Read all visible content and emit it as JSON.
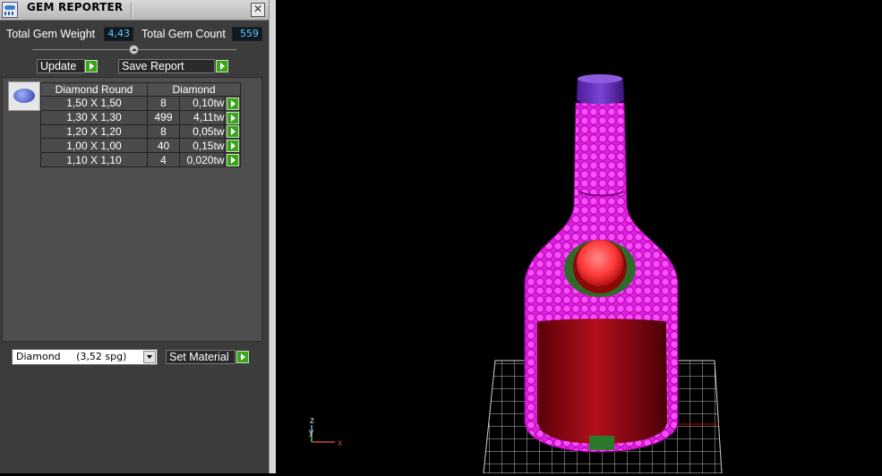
{
  "window": {
    "title": "GEM REPORTER",
    "close_symbol": "✕"
  },
  "totals": {
    "weight_label": "Total Gem Weight",
    "weight_value": "4,43",
    "count_label": "Total Gem Count",
    "count_value": "559"
  },
  "buttons": {
    "update": "Update",
    "save_report": "Save Report",
    "set_material": "Set Material"
  },
  "table": {
    "headers": [
      "Diamond Round",
      "Diamond"
    ],
    "rows": [
      {
        "size": "1,50 X 1,50",
        "count": "8",
        "weight": "0,10tw"
      },
      {
        "size": "1,30 X 1,30",
        "count": "499",
        "weight": "4,11tw"
      },
      {
        "size": "1,20 X 1,20",
        "count": "8",
        "weight": "0,05tw"
      },
      {
        "size": "1,00 X 1,00",
        "count": "40",
        "weight": "0,15tw"
      },
      {
        "size": "1,10 X 1,10",
        "count": "4",
        "weight": "0,020tw"
      }
    ]
  },
  "material": {
    "selected": "Diamond     (3,52 spg)"
  },
  "viewport": {
    "axis": {
      "z": "z",
      "y": "y",
      "x": "x"
    },
    "colors": {
      "gems": "#ff33ff",
      "label": "#c1121a",
      "cap": "#6a2fc0",
      "grid": "#bdbdbd"
    }
  },
  "icons": {
    "app": "gem-reporter-app-icon",
    "go": "green-arrow-icon",
    "thumb": "diamond-round-icon"
  }
}
